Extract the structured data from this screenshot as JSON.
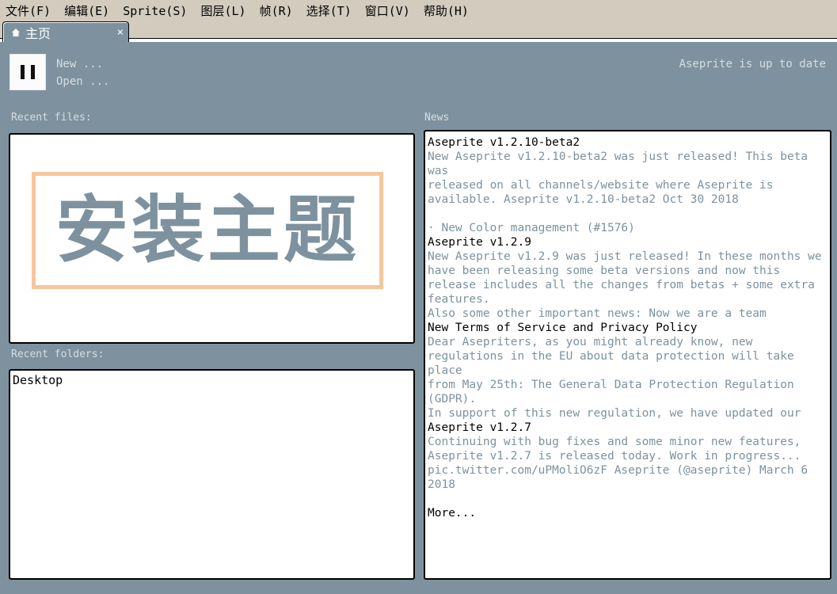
{
  "menubar": {
    "items": [
      "文件(F)",
      "编辑(E)",
      "Sprite(S)",
      "图层(L)",
      "帧(R)",
      "选择(T)",
      "窗口(V)",
      "帮助(H)"
    ]
  },
  "tab": {
    "title": "主页",
    "close": "×",
    "icon": "home-icon"
  },
  "shortcuts": {
    "new_file": "New ...",
    "open_file": "Open ..."
  },
  "status": "Aseprite is up to date",
  "recent_files_label": "Recent files:",
  "install_theme_label": "安装主题",
  "recent_folders_label": "Recent folders:",
  "recent_folders": [
    "Desktop"
  ],
  "news_label": "News",
  "news": [
    {
      "title": "Aseprite v1.2.10-beta2",
      "body": "New Aseprite v1.2.10-beta2 was just released! This beta was\nreleased on all channels/website where Aseprite is\navailable. Aseprite v1.2.10-beta2 Oct 30 2018\n\n· New Color management (#1576)"
    },
    {
      "title": "Aseprite v1.2.9",
      "body": "New Aseprite v1.2.9 was just released! In these months we\nhave been releasing some beta versions and now this\nrelease includes all the changes from betas + some extra\nfeatures.\nAlso some other important news: Now we are a team"
    },
    {
      "title": "New Terms of Service and Privacy Policy",
      "body": "Dear Asepriters, as you might already know, new\nregulations in the EU about data protection will take place\nfrom May 25th: The General Data Protection Regulation\n(GDPR).\nIn support of this new regulation, we have updated our"
    },
    {
      "title": "Aseprite v1.2.7",
      "body": "Continuing with bug fixes and some minor new features,\nAseprite v1.2.7 is released today.  Work in progress...\npic.twitter.com/uPMoliO6zF Aseprite (@aseprite) March 6\n2018"
    }
  ],
  "more_label": "More..."
}
